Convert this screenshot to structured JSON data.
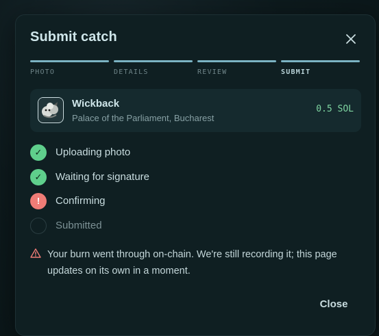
{
  "modal": {
    "title": "Submit catch",
    "close_label": "Close"
  },
  "steps": [
    {
      "label": "PHOTO",
      "active": false
    },
    {
      "label": "DETAILS",
      "active": false
    },
    {
      "label": "REVIEW",
      "active": false
    },
    {
      "label": "SUBMIT",
      "active": true
    }
  ],
  "catch_card": {
    "name": "Wickback",
    "location": "Palace of the Parliament, Bucharest",
    "amount": "0.5 SOL"
  },
  "statuses": [
    {
      "label": "Uploading photo",
      "state": "done",
      "glyph": "✓"
    },
    {
      "label": "Waiting for signature",
      "state": "done",
      "glyph": "✓"
    },
    {
      "label": "Confirming",
      "state": "error",
      "glyph": "!"
    },
    {
      "label": "Submitted",
      "state": "pending",
      "glyph": ""
    }
  ],
  "notice": {
    "icon": "warning-triangle-icon",
    "message": "Your burn went through on-chain. We're still recording it; this page updates on its own in a moment."
  },
  "colors": {
    "accent_bar": "#7bb3c3",
    "success": "#5fcf8c",
    "error": "#ef7c76",
    "amount": "#7fd6a2"
  }
}
